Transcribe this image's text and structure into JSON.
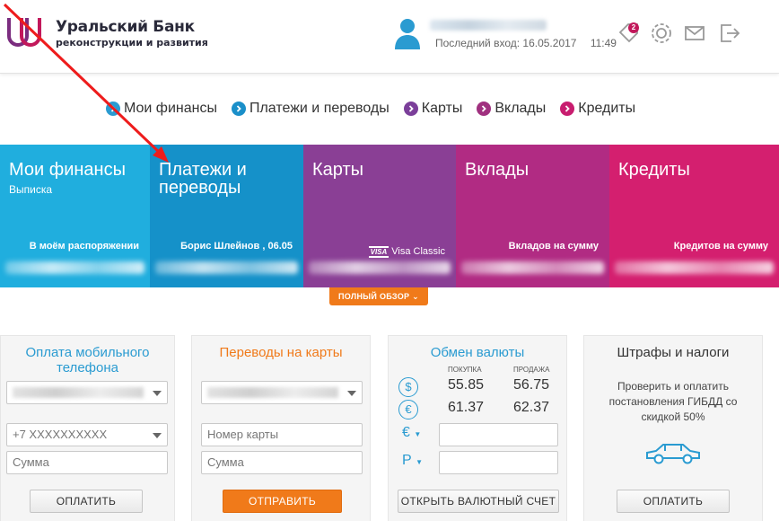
{
  "header": {
    "bank_name": "Уральский Банк",
    "bank_subtitle": "реконструкции и развития",
    "last_login_label": "Последний вход: 16.05.2017",
    "last_login_time": "11:49",
    "notifications_count": "2",
    "icons": [
      "notification-tag-icon",
      "settings-gear-icon",
      "mail-icon",
      "logout-icon"
    ]
  },
  "nav": {
    "items": [
      {
        "label": "Мои финансы",
        "color": "#2a9bd1"
      },
      {
        "label": "Платежи и переводы",
        "color": "#1a8fc9"
      },
      {
        "label": "Карты",
        "color": "#7b3f9a"
      },
      {
        "label": "Вклады",
        "color": "#a0307f"
      },
      {
        "label": "Кредиты",
        "color": "#c81d6f"
      }
    ]
  },
  "tiles": [
    {
      "title": "Мои финансы",
      "subtitle": "Выписка",
      "info": "В моём распоряжении",
      "color": "#20aede"
    },
    {
      "title": "Платежи и переводы",
      "subtitle": "",
      "info": "Борис Шлейнов , 06.05",
      "color": "#1591c9"
    },
    {
      "title": "Карты",
      "subtitle": "",
      "visa_mark": "VISA",
      "info": "Visa Classic",
      "color": "#8a3f95"
    },
    {
      "title": "Вклады",
      "subtitle": "",
      "info": "Вкладов на сумму",
      "color": "#b12b83"
    },
    {
      "title": "Кредиты",
      "subtitle": "",
      "info": "Кредитов на сумму",
      "color": "#d41f6f"
    }
  ],
  "overview_button": "ПОЛНЫЙ ОБЗОР",
  "cards": {
    "mobile": {
      "title": "Оплата мобильного телефона",
      "phone_placeholder": "+7  XXXXXXXXXX",
      "amount_placeholder": "Сумма",
      "button": "ОПЛАТИТЬ",
      "title_color": "#2a9bd1"
    },
    "card_transfer": {
      "title": "Переводы на карты",
      "card_number_placeholder": "Номер карты",
      "amount_placeholder": "Сумма",
      "button": "ОТПРАВИТЬ",
      "title_color": "#f07a1a"
    },
    "exchange": {
      "title": "Обмен валюты",
      "buy_label": "ПОКУПКА",
      "sell_label": "ПРОДАЖА",
      "rates": [
        {
          "currency_icon": "dollar-icon",
          "symbol": "$",
          "buy": "55.85",
          "sell": "56.75"
        },
        {
          "currency_icon": "euro-icon",
          "symbol": "€",
          "buy": "61.37",
          "sell": "62.37"
        }
      ],
      "from_currency": "€",
      "to_currency": "Р",
      "button": "ОТКРЫТЬ ВАЛЮТНЫЙ СЧЕТ",
      "title_color": "#2a9bd1"
    },
    "fines": {
      "title": "Штрафы и налоги",
      "description": "Проверить и оплатить постановления ГИБДД со скидкой 50%",
      "button": "ОПЛАТИТЬ",
      "title_color": "#333333"
    }
  }
}
